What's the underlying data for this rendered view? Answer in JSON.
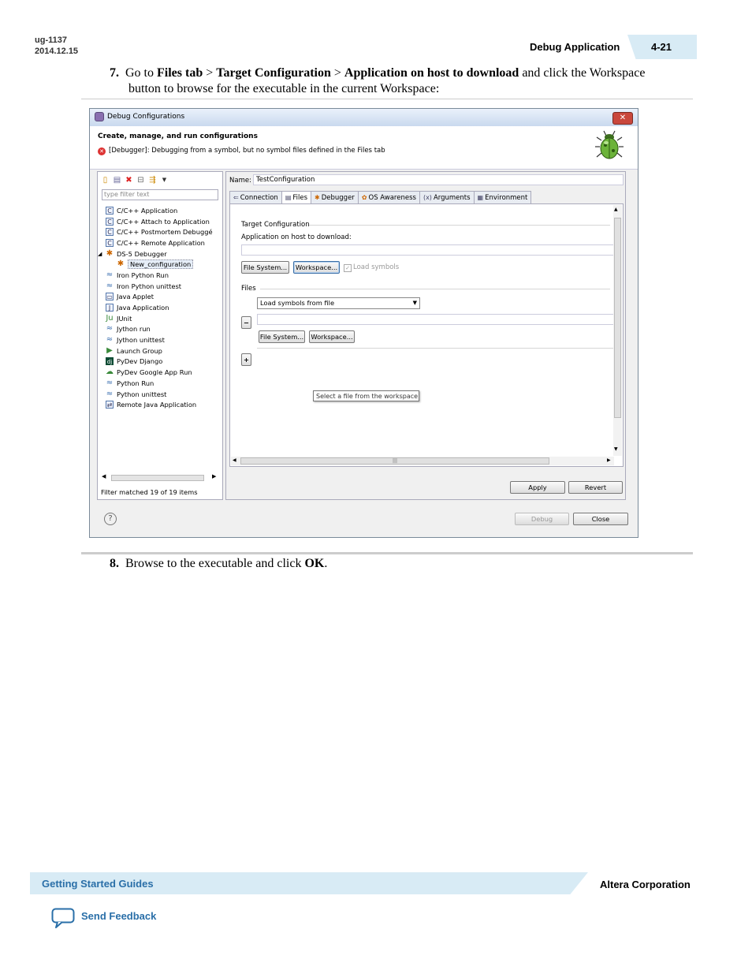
{
  "header": {
    "doc_id": "ug-1137",
    "doc_date": "2014.12.15",
    "section_title": "Debug Application",
    "page_number": "4-21"
  },
  "step7": {
    "number": "7.",
    "text_1": "Go to ",
    "bold_1": "Files tab",
    "text_2": " > ",
    "bold_2": "Target Configuration",
    "text_3": " > ",
    "bold_3": "Application on host to download",
    "text_4": " and click the Workspace",
    "line2": "button to browse for the executable in the current Workspace:"
  },
  "dialog": {
    "title": "Debug Configurations",
    "close_glyph": "✕",
    "heading": "Create, manage, and run configurations",
    "error": "[Debugger]: Debugging from a symbol, but no symbol files defined in the Files tab",
    "filter_placeholder": "type filter text",
    "tree": [
      {
        "label": "C/C++ Application",
        "icon": "c-icon"
      },
      {
        "label": "C/C++ Attach to Application",
        "icon": "c-icon"
      },
      {
        "label": "C/C++ Postmortem Debuggé",
        "icon": "c-icon"
      },
      {
        "label": "C/C++ Remote Application",
        "icon": "c-icon"
      },
      {
        "label": "DS-5 Debugger",
        "icon": "ds5-icon"
      },
      {
        "label": "New_configuration",
        "icon": "ds5-icon"
      },
      {
        "label": "Iron Python Run",
        "icon": "python-icon"
      },
      {
        "label": "Iron Python unittest",
        "icon": "python-icon"
      },
      {
        "label": "Java Applet",
        "icon": "applet-icon"
      },
      {
        "label": "Java Application",
        "icon": "java-icon"
      },
      {
        "label": "JUnit",
        "icon": "junit-icon"
      },
      {
        "label": "Jython run",
        "icon": "python-icon"
      },
      {
        "label": "Jython unittest",
        "icon": "python-icon"
      },
      {
        "label": "Launch Group",
        "icon": "launch-icon"
      },
      {
        "label": "PyDev Django",
        "icon": "django-icon"
      },
      {
        "label": "PyDev Google App Run",
        "icon": "google-icon"
      },
      {
        "label": "Python Run",
        "icon": "python-icon"
      },
      {
        "label": "Python unittest",
        "icon": "python-icon"
      },
      {
        "label": "Remote Java Application",
        "icon": "remote-icon"
      }
    ],
    "filter_status": "Filter matched 19 of 19 items",
    "name_label": "Name:",
    "name_value": "TestConfiguration",
    "tabs": [
      "Connection",
      "Files",
      "Debugger",
      "OS Awareness",
      "Arguments",
      "Environment"
    ],
    "target_config_label": "Target Configuration",
    "app_on_host_label": "Application on host to download:",
    "file_system_button": "File System...",
    "workspace_button": "Workspace...",
    "load_symbols": "Load symbols",
    "files_label": "Files",
    "tooltip": "Select a file from the workspace",
    "select_value": "Load symbols from file",
    "minus": "−",
    "plus": "+",
    "file_system_button_2": "File System...",
    "workspace_button_2": "Workspace...",
    "apply_button": "Apply",
    "revert_button": "Revert",
    "debug_button": "Debug",
    "close_button": "Close",
    "help_glyph": "?"
  },
  "step8": {
    "number": "8.",
    "text_1": "Browse to the executable and click ",
    "bold_1": "OK",
    "text_2": "."
  },
  "footer": {
    "guide": "Getting Started Guides",
    "company": "Altera Corporation",
    "feedback": "Send Feedback"
  },
  "colors": {
    "accent_band": "#d8ebf5",
    "link_blue": "#2a6fa8"
  }
}
